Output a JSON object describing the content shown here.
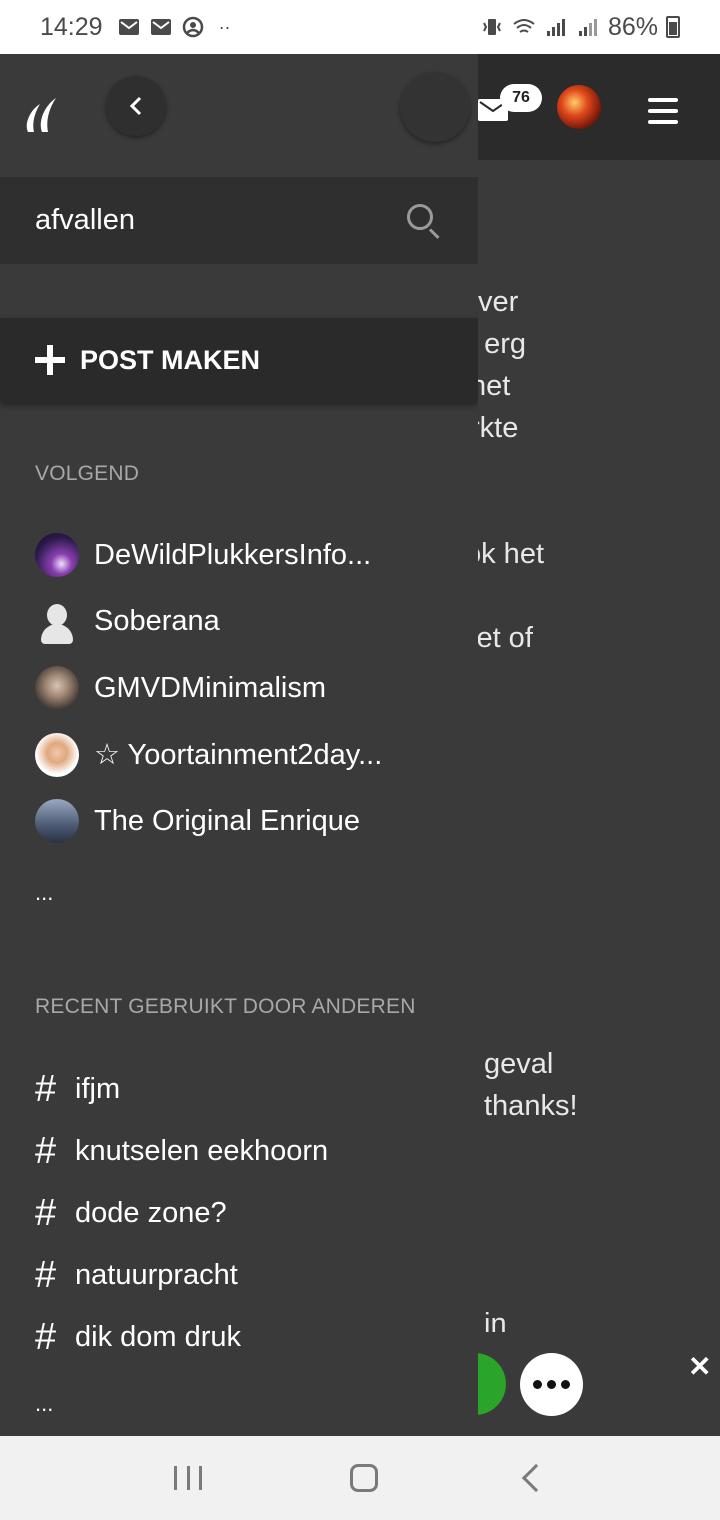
{
  "status_bar": {
    "time": "14:29",
    "battery": "86%",
    "left_icons": [
      "gmail-icon",
      "gmail-icon",
      "account-circle-icon",
      "more-dots-icon"
    ],
    "right_icons": [
      "vibrate-icon",
      "wifi-icon",
      "signal-icon",
      "signal-icon",
      "battery-icon"
    ]
  },
  "header": {
    "mail_badge": "76"
  },
  "drawer": {
    "search": {
      "value": "afvallen"
    },
    "post_button": "POST MAKEN",
    "following": {
      "label": "VOLGEND",
      "items": [
        {
          "name": "DeWildPlukkersInfo..."
        },
        {
          "name": "Soberana"
        },
        {
          "name": "GMVDMinimalism"
        },
        {
          "name": "☆ Yoortainment2day..."
        },
        {
          "name": "The Original Enrique"
        }
      ],
      "more": "..."
    },
    "recent": {
      "label": "RECENT GEBRUIKT DOOR ANDEREN",
      "items": [
        {
          "tag": "ifjm"
        },
        {
          "tag": "knutselen eekhoorn"
        },
        {
          "tag": "dode zone?"
        },
        {
          "tag": "natuurpracht"
        },
        {
          "tag": "dik dom druk"
        }
      ],
      "more": "..."
    }
  },
  "background_text": {
    "lines": [
      "ver",
      "t erg",
      "het",
      "rkte",
      "ok het",
      "iet of",
      "geval",
      "thanks!",
      "in"
    ]
  },
  "floating": {
    "close": "✕"
  },
  "colors": {
    "drawer_bg": "#3a3a3a",
    "header_bg": "#2b2b2b",
    "accent_green": "#2aa52a"
  }
}
